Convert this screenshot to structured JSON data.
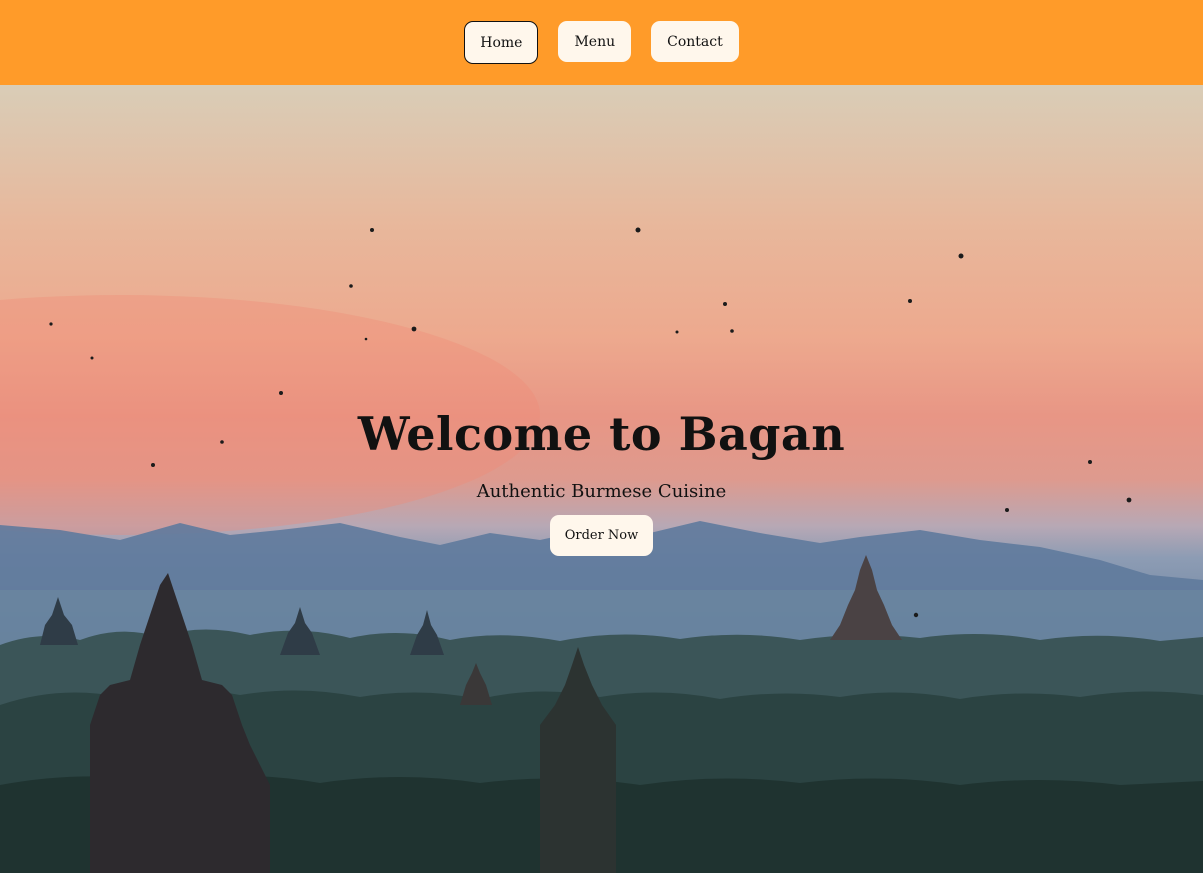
{
  "nav": {
    "items": [
      {
        "label": "Home",
        "active": true
      },
      {
        "label": "Menu",
        "active": false
      },
      {
        "label": "Contact",
        "active": false
      }
    ]
  },
  "hero": {
    "title": "Welcome to Bagan",
    "subtitle": "Authentic Burmese Cuisine",
    "cta_label": "Order Now"
  },
  "colors": {
    "nav_background": "#ff9b29",
    "button_background": "#fff7ec"
  }
}
